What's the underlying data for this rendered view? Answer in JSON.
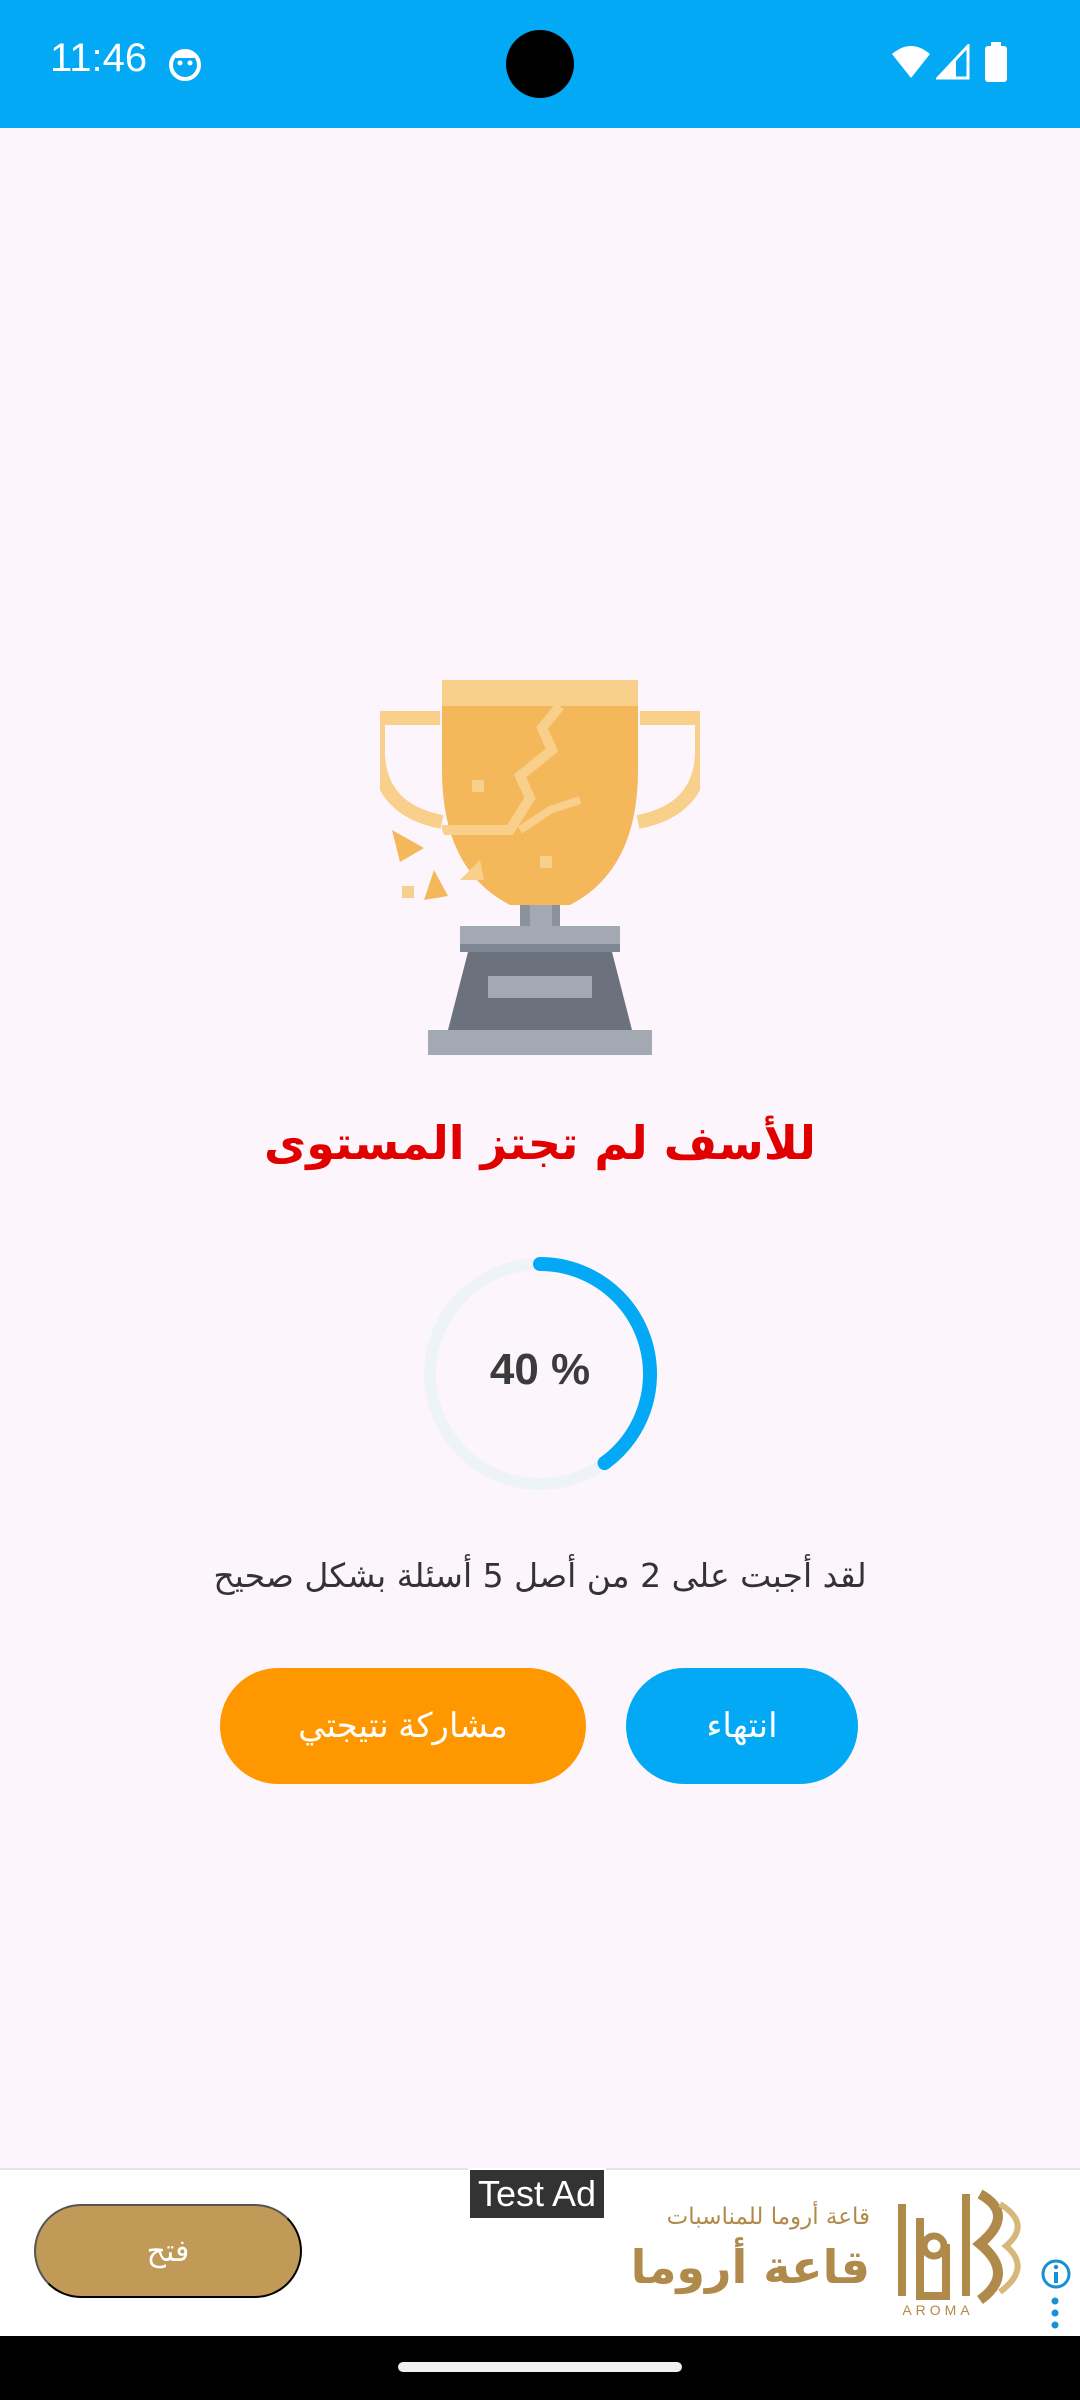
{
  "status_bar": {
    "time": "11:46",
    "color": "#03a9f4",
    "icons": [
      "app-notification-icon",
      "wifi-icon",
      "signal-icon",
      "battery-icon"
    ]
  },
  "result": {
    "title": "للأسف لم تجتز المستوى",
    "title_color": "#e00000",
    "percent": 40,
    "percent_label": "40 %",
    "description": "لقد أجبت على 2 من أصل 5 أسئلة بشكل صحيح"
  },
  "buttons": {
    "share_label": "مشاركة نتيجتي",
    "finish_label": "انتهاء",
    "share_color": "#ff9800",
    "finish_color": "#03a9f4"
  },
  "ad": {
    "badge": "Test Ad",
    "open_label": "فتح",
    "subtitle": "قاعة أروما للمناسبات",
    "title": "قاعة أروما",
    "logo_text": "AROMA",
    "accent": "#c09a56"
  }
}
